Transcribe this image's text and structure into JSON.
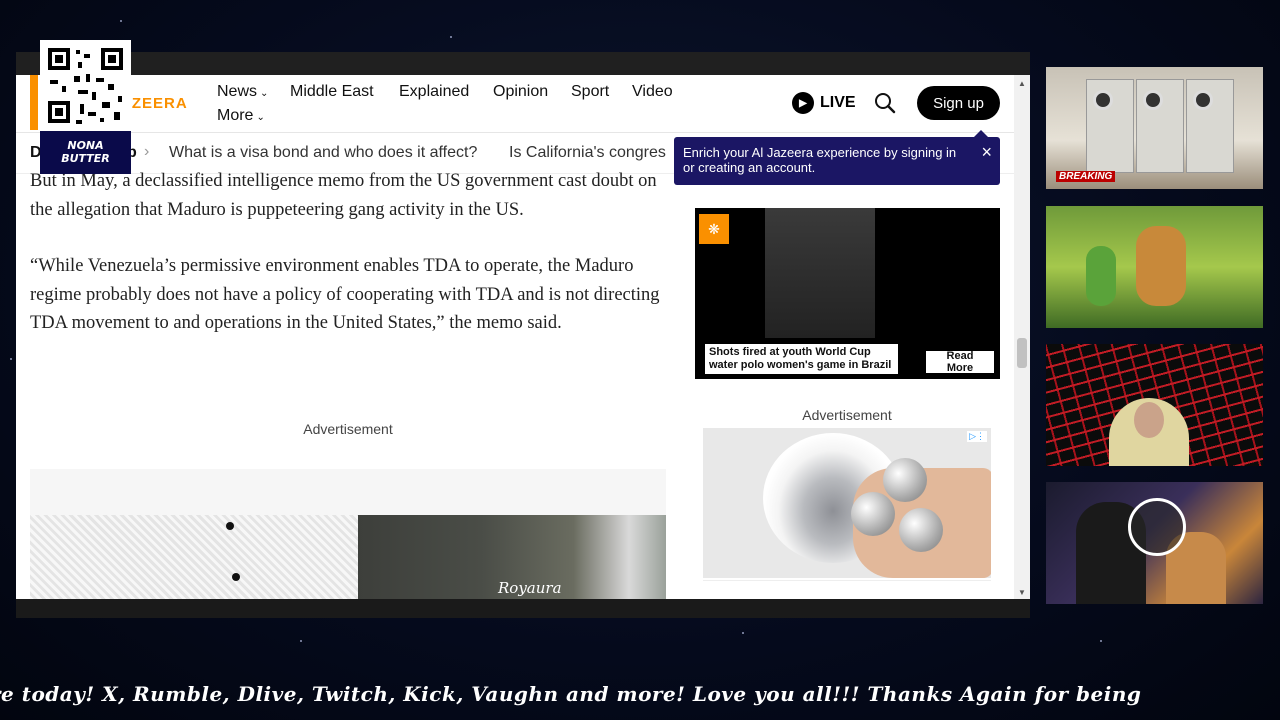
{
  "header": {
    "logo_text": "AZEERA",
    "nav": [
      {
        "label": "News",
        "chevron": true
      },
      {
        "label": "Middle East",
        "chevron": false
      },
      {
        "label": "Explained",
        "chevron": false
      },
      {
        "label": "Opinion",
        "chevron": false
      },
      {
        "label": "Sport",
        "chevron": false
      },
      {
        "label": "Video",
        "chevron": false
      },
      {
        "label": "More",
        "chevron": true
      }
    ],
    "live_label": "LIVE",
    "signup_label": "Sign up"
  },
  "breadcrumb": {
    "lead": "D",
    "lead2": "p",
    "items": [
      "What is a visa bond and who does it affect?",
      "Is California's congres"
    ]
  },
  "popup": {
    "text": "Enrich your Al Jazeera experience by signing in or creating an account.",
    "close": "×"
  },
  "article": {
    "paragraphs": [
      "But in May, a declassified intelligence memo from the US government cast doubt on the allegation that Maduro is puppeteering gang activity in the US.",
      "“While Venezuela’s permissive environment enables TDA to operate, the Maduro regime probably does not have a policy of cooperating with TDA and is not directing TDA movement to and operations in the United States,” the memo said."
    ]
  },
  "ads": {
    "left_label": "Advertisement",
    "right_label": "Advertisement",
    "shirt_brand": "Royaura"
  },
  "video_card": {
    "caption": "Shots fired at youth World Cup water polo women's game in Brazil",
    "read_more": "Read More"
  },
  "overlay": {
    "qr_caption_line1": "NONA",
    "qr_caption_line2": "BUTTER"
  },
  "tiles": {
    "breaking_label": "BREAKING"
  },
  "ticker": {
    "text": "re today! X, Rumble, Dlive, Twitch, Kick, Vaughn and more! Love you all!!! Thanks Again for being"
  },
  "colors": {
    "brand": "#fa9000",
    "popup_bg": "#1b1664",
    "qr_label_bg": "#0a0a4a"
  }
}
